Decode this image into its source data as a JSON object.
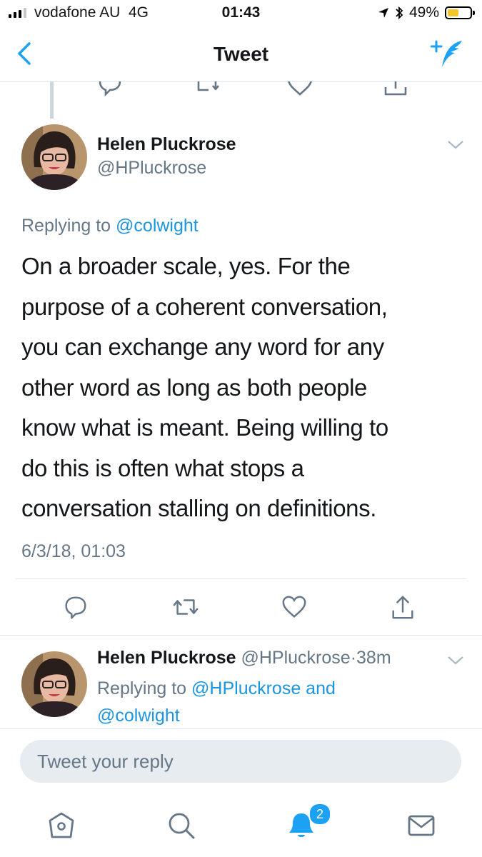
{
  "status_bar": {
    "carrier": "vodafone AU",
    "network": "4G",
    "time": "01:43",
    "battery_percent": "49%",
    "battery_level": 0.49,
    "battery_color": "#f5c52a"
  },
  "header": {
    "title": "Tweet",
    "back_icon": "chevron-left-icon",
    "compose_icon": "compose-tweet-icon"
  },
  "main_tweet": {
    "author_name": "Helen Pluckrose",
    "author_handle": "@HPluckrose",
    "replying_prefix": "Replying to",
    "replying_to": "@colwight",
    "text_lines": [
      "On a broader scale, yes. For the",
      "purpose of a coherent conversation,",
      "you can exchange any word for any",
      "other word as long as both people",
      "know what is meant. Being willing to",
      "do this is often what stops a",
      "conversation stalling on definitions."
    ],
    "timestamp": "6/3/18, 01:03"
  },
  "reply_tweet": {
    "author_name": "Helen Pluckrose",
    "author_handle": "@HPluckrose",
    "separator": "·",
    "time_ago": "38m",
    "replying_prefix": "Replying to",
    "replying_to_1": "@HPluckrose and",
    "replying_to_2": "@colwight"
  },
  "reply_input": {
    "placeholder": "Tweet your reply"
  },
  "tab_bar": {
    "tabs": [
      "home-icon",
      "search-icon",
      "notifications-icon",
      "messages-icon"
    ],
    "notification_count": "2"
  },
  "colors": {
    "accent": "#1da1f2",
    "link": "#1b95e0",
    "secondary_text": "#657786"
  }
}
